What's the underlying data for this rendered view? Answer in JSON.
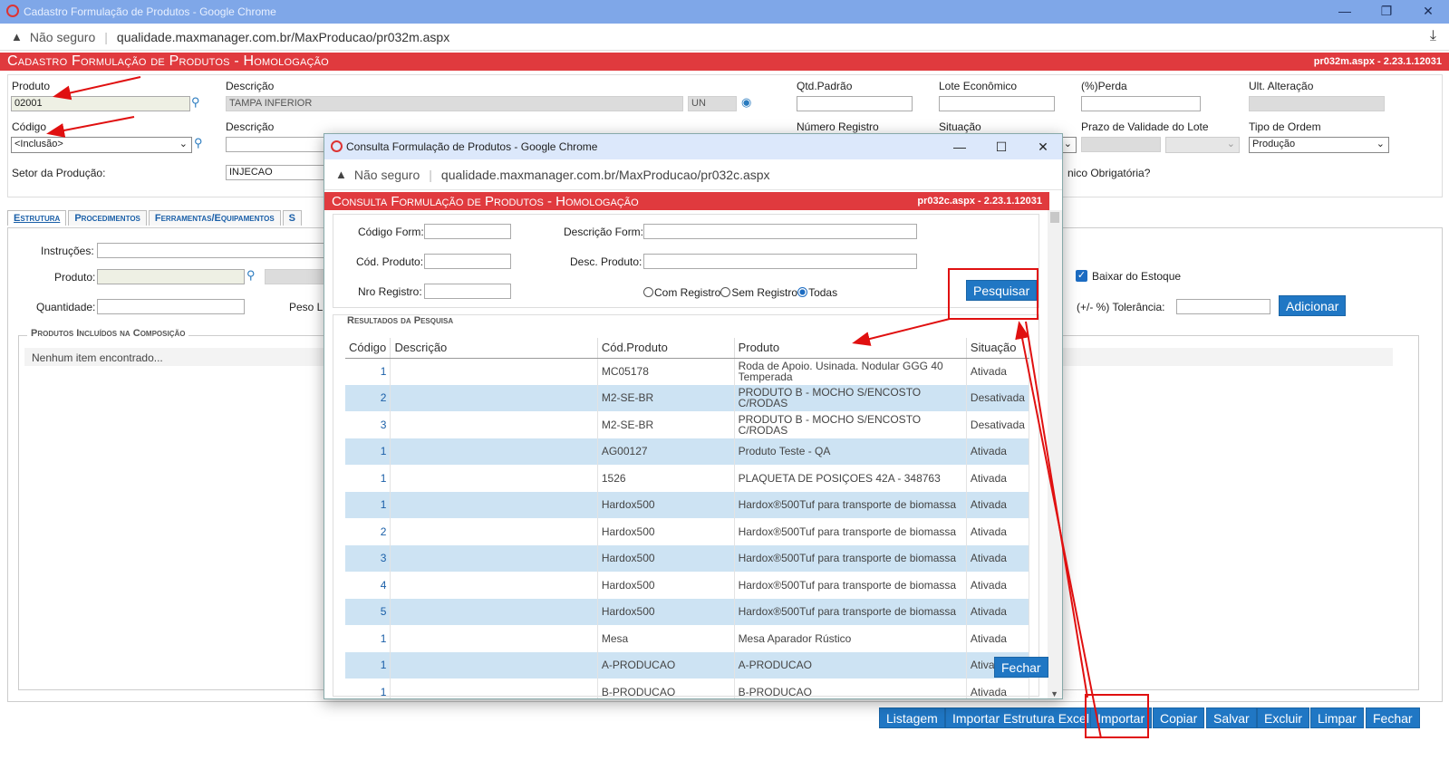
{
  "window": {
    "title": "Cadastro Formulação de Produtos - Google Chrome",
    "not_secure": "Não seguro",
    "url": "qualidade.maxmanager.com.br/MaxProducao/pr032m.aspx"
  },
  "header": {
    "title": "Cadastro Formulação de Produtos  - Homologação",
    "version": "pr032m.aspx - 2.23.1.12031"
  },
  "form": {
    "produto_label": "Produto",
    "produto_value": "02001",
    "descricao_label": "Descrição",
    "descricao_value": "TAMPA INFERIOR",
    "unidade_value": "UN",
    "qtd_padrao_label": "Qtd.Padrão",
    "lote_economico_label": "Lote Econômico",
    "perda_label": "(%)Perda",
    "ult_alteracao_label": "Ult. Alteração",
    "codigo_label": "Código",
    "codigo_value": "<Inclusão>",
    "descricao2_label": "Descrição",
    "numero_registro_label": "Número Registro",
    "situacao_label": "Situação",
    "prazo_validade_label": "Prazo de Validade do Lote",
    "tipo_ordem_label": "Tipo de Ordem",
    "tipo_ordem_value": "Produção",
    "setor_label": "Setor da Produção:",
    "setor_value": "INJECAO",
    "obrigatoria_label": "nico Obrigatória?"
  },
  "tabs": [
    {
      "label": "Estrutura"
    },
    {
      "label": "Procedimentos"
    },
    {
      "label": "Ferramentas/Equipamentos"
    },
    {
      "label": "S"
    }
  ],
  "estrutura": {
    "instrucoes_label": "Instruções:",
    "produto_label": "Produto:",
    "quantidade_label": "Quantidade:",
    "peso_label": "Peso Lí",
    "baixar_estoque_label": "Baixar do Estoque",
    "tolerancia_label": "(+/- %) Tolerância:",
    "adicionar_label": "Adicionar",
    "composicao_legend": "Produtos Incluídos na Composição",
    "empty_text": "Nenhum item encontrado..."
  },
  "bottom_buttons": {
    "listagem": "Listagem",
    "importar_excel": "Importar Estrutura Excel",
    "importar": "Importar",
    "copiar": "Copiar",
    "salvar": "Salvar",
    "excluir": "Excluir",
    "limpar": "Limpar",
    "fechar": "Fechar"
  },
  "popup": {
    "title": "Consulta Formulação de Produtos - Google Chrome",
    "not_secure": "Não seguro",
    "url": "qualidade.maxmanager.com.br/MaxProducao/pr032c.aspx",
    "header_title": "Consulta Formulação de Produtos  - Homologação",
    "header_version": "pr032c.aspx - 2.23.1.12031",
    "codigo_form_label": "Código Form:",
    "descricao_form_label": "Descrição Form:",
    "cod_produto_label": "Cód. Produto:",
    "desc_produto_label": "Desc. Produto:",
    "nro_registro_label": "Nro Registro:",
    "radio_com": "Com Registro",
    "radio_sem": "Sem Registro",
    "radio_todas": "Todas",
    "pesquisar_label": "Pesquisar",
    "results_legend": "Resultados da Pesquisa",
    "fechar_label": "Fechar",
    "columns": [
      "Código",
      "Descrição",
      "Cód.Produto",
      "Produto",
      "Situação"
    ],
    "rows": [
      {
        "codigo": "1",
        "descricao": "",
        "cod_produto": "MC05178",
        "produto": "Roda de Apoio. Usinada. Nodular GGG 40 Temperada",
        "situacao": "Ativada"
      },
      {
        "codigo": "2",
        "descricao": "",
        "cod_produto": "M2-SE-BR",
        "produto": "PRODUTO B - MOCHO S/ENCOSTO C/RODAS",
        "situacao": "Desativada"
      },
      {
        "codigo": "3",
        "descricao": "",
        "cod_produto": "M2-SE-BR",
        "produto": "PRODUTO B - MOCHO S/ENCOSTO C/RODAS",
        "situacao": "Desativada"
      },
      {
        "codigo": "1",
        "descricao": "",
        "cod_produto": "AG00127",
        "produto": "Produto Teste - QA",
        "situacao": "Ativada"
      },
      {
        "codigo": "1",
        "descricao": "",
        "cod_produto": "1526",
        "produto": "PLAQUETA DE POSIÇOES 42A - 348763",
        "situacao": "Ativada"
      },
      {
        "codigo": "1",
        "descricao": "",
        "cod_produto": "Hardox500",
        "produto": "Hardox®500Tuf para transporte de biomassa",
        "situacao": "Ativada"
      },
      {
        "codigo": "2",
        "descricao": "",
        "cod_produto": "Hardox500",
        "produto": "Hardox®500Tuf para transporte de biomassa",
        "situacao": "Ativada"
      },
      {
        "codigo": "3",
        "descricao": "",
        "cod_produto": "Hardox500",
        "produto": "Hardox®500Tuf para transporte de biomassa",
        "situacao": "Ativada"
      },
      {
        "codigo": "4",
        "descricao": "",
        "cod_produto": "Hardox500",
        "produto": "Hardox®500Tuf para transporte de biomassa",
        "situacao": "Ativada"
      },
      {
        "codigo": "5",
        "descricao": "",
        "cod_produto": "Hardox500",
        "produto": "Hardox®500Tuf para transporte de biomassa",
        "situacao": "Ativada"
      },
      {
        "codigo": "1",
        "descricao": "",
        "cod_produto": "Mesa",
        "produto": "Mesa Aparador Rústico",
        "situacao": "Ativada"
      },
      {
        "codigo": "1",
        "descricao": "",
        "cod_produto": "A-PRODUCAO",
        "produto": "A-PRODUCAO",
        "situacao": "Ativa"
      },
      {
        "codigo": "1",
        "descricao": "",
        "cod_produto": "B-PRODUCAO",
        "produto": "B-PRODUCAO",
        "situacao": "Ativada"
      }
    ]
  },
  "colors": {
    "header_red": "#e03a3e",
    "button_blue": "#2077c4",
    "row_alt": "#cde3f3",
    "annotation_red": "#e01010"
  }
}
